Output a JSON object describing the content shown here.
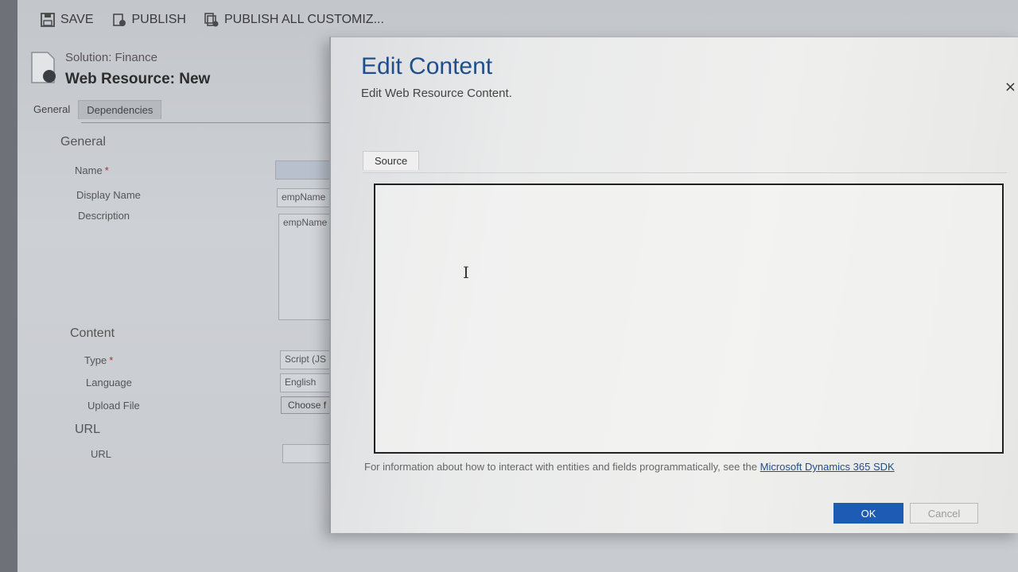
{
  "toolbar": {
    "save_label": "SAVE",
    "publish_label": "PUBLISH",
    "publish_all_label": "PUBLISH ALL CUSTOMIZ..."
  },
  "header": {
    "solution": "Solution: Finance",
    "title": "Web Resource: New"
  },
  "tabs": [
    {
      "label": "General"
    },
    {
      "label": "Dependencies"
    }
  ],
  "general": {
    "section_title": "General",
    "name_label": "Name",
    "name_value": "",
    "display_name_label": "Display Name",
    "display_name_value": "empName",
    "description_label": "Description",
    "description_value": "empName"
  },
  "content": {
    "section_title": "Content",
    "type_label": "Type",
    "type_value": "Script (JS",
    "language_label": "Language",
    "language_value": "English",
    "upload_label": "Upload File",
    "choose_label": "Choose f"
  },
  "url_section": {
    "section_title": "URL",
    "url_label": "URL",
    "url_value": ""
  },
  "required_marker": "*",
  "dialog": {
    "title": "Edit Content",
    "subtitle": "Edit Web Resource Content.",
    "close": "×",
    "tab_label": "Source",
    "editor_value": "",
    "info_text": "For information about how to interact with entities and fields programmatically, see the ",
    "link_text": "Microsoft Dynamics 365 SDK",
    "ok_label": "OK",
    "cancel_label": "Cancel"
  },
  "colors": {
    "accent": "#1d5bb5",
    "title_blue": "#1f4e8d"
  }
}
